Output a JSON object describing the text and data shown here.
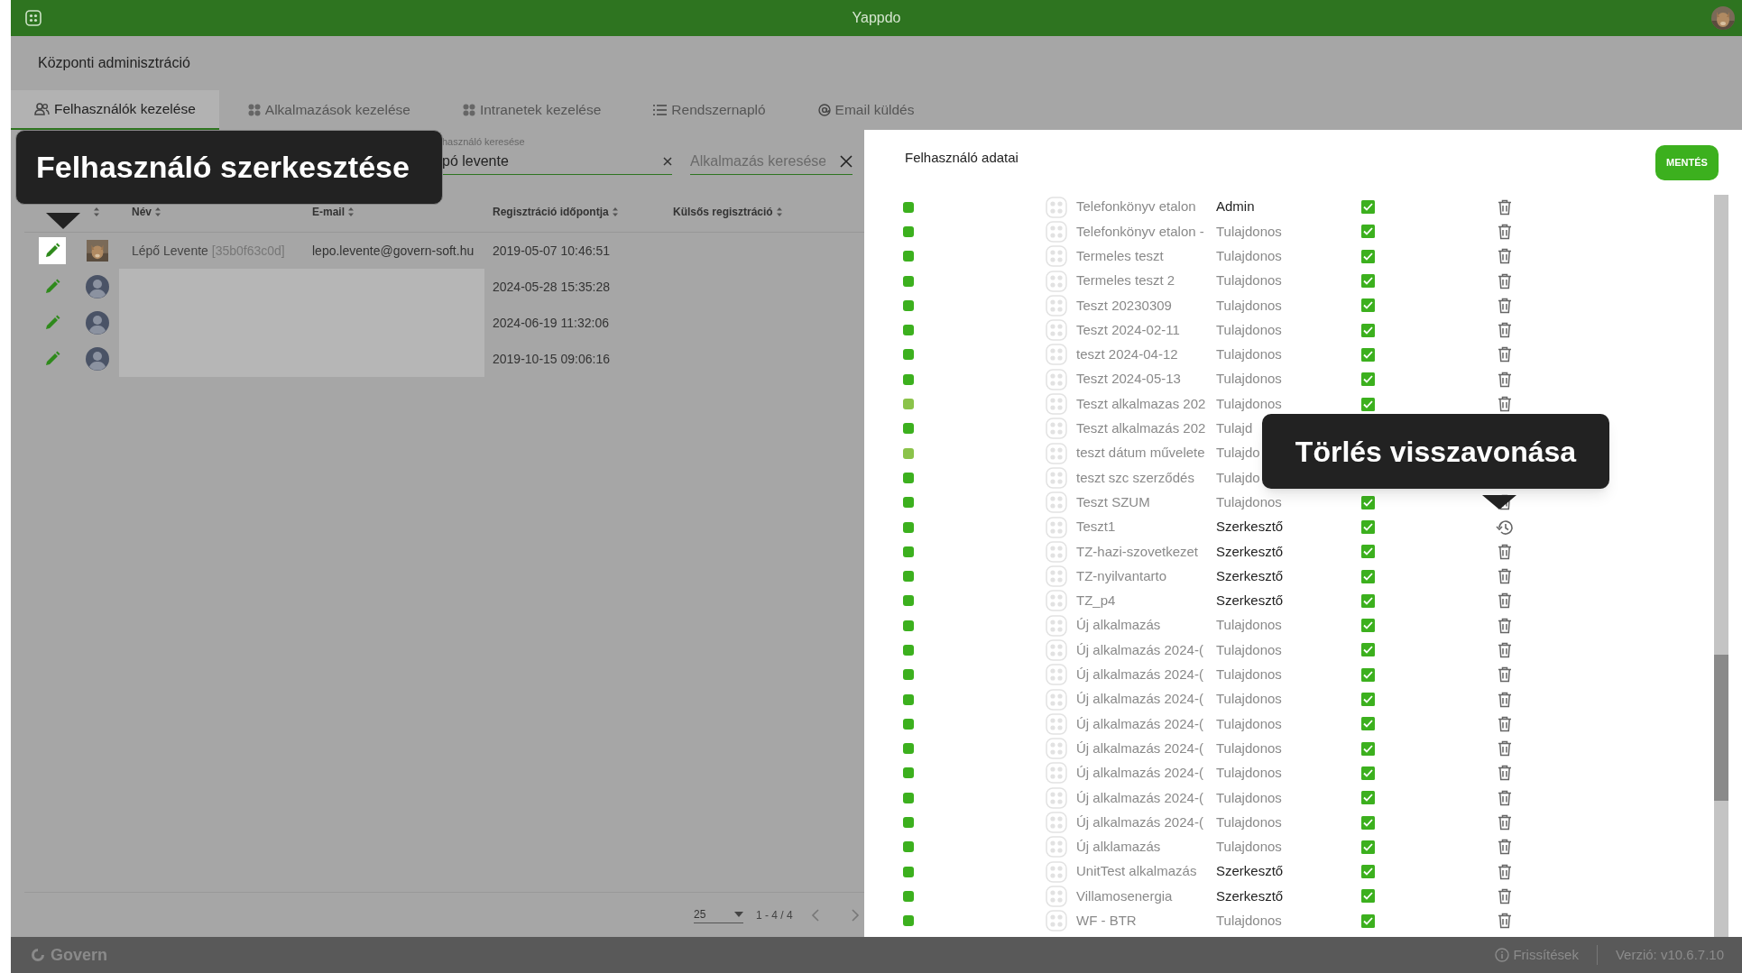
{
  "top_bar": {
    "title": "Yappdo"
  },
  "header": {
    "title": "Központi adminisztráció"
  },
  "tabs": [
    {
      "label": "Felhasználók kezelése",
      "selected": true
    },
    {
      "label": "Alkalmazások kezelése",
      "selected": false
    },
    {
      "label": "Intranetek kezelése",
      "selected": false
    },
    {
      "label": "Rendszernapló",
      "selected": false
    },
    {
      "label": "Email küldés",
      "selected": false
    }
  ],
  "user_search": {
    "label": "használó keresése",
    "value": "pó levente"
  },
  "app_search": {
    "placeholder": "Alkalmazás keresése"
  },
  "tooltip_edit": {
    "text": "Felhasználó szerkesztése"
  },
  "table": {
    "columns": [
      "Név",
      "E-mail",
      "Regisztráció időpontja",
      "Külsős regisztráció"
    ],
    "rows": [
      {
        "selected": true,
        "blurred": false,
        "name": "Lépő Levente",
        "id": "[35b0f63c0d]",
        "email": "lepo.levente@govern-soft.hu",
        "registered": "2019-05-07 10:46:51"
      },
      {
        "selected": false,
        "kind": "default",
        "blurred": true,
        "registered": "2024-05-28 15:35:28"
      },
      {
        "selected": false,
        "kind": "default",
        "blurred": true,
        "registered": "2024-06-19 11:32:06"
      },
      {
        "selected": false,
        "kind": "default",
        "blurred": true,
        "registered": "2019-10-15 09:06:16"
      }
    ]
  },
  "pagination": {
    "page_size": "25",
    "range": "1 - 4 / 4"
  },
  "panel": {
    "title": "Felhasználó adatai",
    "save_button": "MENTÉS"
  },
  "tooltip_restore": {
    "text": "Törlés visszavonása"
  },
  "apps": [
    {
      "color": "#3cb01e",
      "name": "Telefonkönyv etalon",
      "role": "Admin",
      "highlight": true,
      "checked": true,
      "kind": "delete"
    },
    {
      "color": "#3cb01e",
      "name": "Telefonkönyv etalon -",
      "role": "Tulajdonos",
      "highlight": false,
      "checked": true,
      "kind": "delete"
    },
    {
      "color": "#3cb01e",
      "name": "Termeles teszt",
      "role": "Tulajdonos",
      "highlight": false,
      "checked": true,
      "kind": "delete"
    },
    {
      "color": "#3cb01e",
      "name": "Termeles teszt 2",
      "role": "Tulajdonos",
      "highlight": false,
      "checked": true,
      "kind": "delete"
    },
    {
      "color": "#3cb01e",
      "name": "Teszt 20230309",
      "role": "Tulajdonos",
      "highlight": false,
      "checked": true,
      "kind": "delete"
    },
    {
      "color": "#3cb01e",
      "name": "Teszt 2024-02-11",
      "role": "Tulajdonos",
      "highlight": false,
      "checked": true,
      "kind": "delete"
    },
    {
      "color": "#3cb01e",
      "name": "teszt 2024-04-12",
      "role": "Tulajdonos",
      "highlight": false,
      "checked": true,
      "kind": "delete"
    },
    {
      "color": "#3cb01e",
      "name": "Teszt 2024-05-13",
      "role": "Tulajdonos",
      "highlight": false,
      "checked": true,
      "kind": "delete"
    },
    {
      "color": "#8bc34a",
      "name": "Teszt alkalmazas 202",
      "role": "Tulajdonos",
      "highlight": false,
      "checked": true,
      "kind": "delete"
    },
    {
      "color": "#3cb01e",
      "name": "Teszt alkalmazás 202",
      "role": "Tulajd",
      "highlight": false
    },
    {
      "color": "#8bc34a",
      "name": "teszt dátum művelete",
      "role": "Tulajdo",
      "highlight": false
    },
    {
      "color": "#3cb01e",
      "name": "teszt szc szerződés",
      "role": "Tulajdo",
      "highlight": false
    },
    {
      "color": "#3cb01e",
      "name": "Teszt SZUM",
      "role": "Tulajdonos",
      "highlight": false,
      "checked": true,
      "kind": "delete"
    },
    {
      "color": "#3cb01e",
      "name": "Teszt1",
      "role": "Szerkesztő",
      "highlight": true,
      "checked": true,
      "kind": "restore"
    },
    {
      "color": "#3cb01e",
      "name": "TZ-hazi-szovetkezet",
      "role": "Szerkesztő",
      "highlight": true,
      "checked": true,
      "kind": "delete"
    },
    {
      "color": "#3cb01e",
      "name": "TZ-nyilvantarto",
      "role": "Szerkesztő",
      "highlight": true,
      "checked": true,
      "kind": "delete"
    },
    {
      "color": "#3cb01e",
      "name": "TZ_p4",
      "role": "Szerkesztő",
      "highlight": true,
      "checked": true,
      "kind": "delete"
    },
    {
      "color": "#3cb01e",
      "name": "Új alkalmazás",
      "role": "Tulajdonos",
      "highlight": false,
      "checked": true,
      "kind": "delete"
    },
    {
      "color": "#3cb01e",
      "name": "Új alkalmazás 2024-(",
      "role": "Tulajdonos",
      "highlight": false,
      "checked": true,
      "kind": "delete"
    },
    {
      "color": "#3cb01e",
      "name": "Új alkalmazás 2024-(",
      "role": "Tulajdonos",
      "highlight": false,
      "checked": true,
      "kind": "delete"
    },
    {
      "color": "#3cb01e",
      "name": "Új alkalmazás 2024-(",
      "role": "Tulajdonos",
      "highlight": false,
      "checked": true,
      "kind": "delete"
    },
    {
      "color": "#3cb01e",
      "name": "Új alkalmazás 2024-(",
      "role": "Tulajdonos",
      "highlight": false,
      "checked": true,
      "kind": "delete"
    },
    {
      "color": "#3cb01e",
      "name": "Új alkalmazás 2024-(",
      "role": "Tulajdonos",
      "highlight": false,
      "checked": true,
      "kind": "delete"
    },
    {
      "color": "#3cb01e",
      "name": "Új alkalmazás 2024-(",
      "role": "Tulajdonos",
      "highlight": false,
      "checked": true,
      "kind": "delete"
    },
    {
      "color": "#3cb01e",
      "name": "Új alkalmazás 2024-(",
      "role": "Tulajdonos",
      "highlight": false,
      "checked": true,
      "kind": "delete"
    },
    {
      "color": "#3cb01e",
      "name": "Új alkalmazás 2024-(",
      "role": "Tulajdonos",
      "highlight": false,
      "checked": true,
      "kind": "delete"
    },
    {
      "color": "#3cb01e",
      "name": "Új alklamazás",
      "role": "Tulajdonos",
      "highlight": false,
      "checked": true,
      "kind": "delete"
    },
    {
      "color": "#3cb01e",
      "name": "UnitTest alkalmazás",
      "role": "Szerkesztő",
      "highlight": true,
      "checked": true,
      "kind": "delete"
    },
    {
      "color": "#3cb01e",
      "name": "Villamosenergia",
      "role": "Szerkesztő",
      "highlight": true,
      "checked": true,
      "kind": "delete"
    },
    {
      "color": "#3cb01e",
      "name": "WF - BTR",
      "role": "Tulajdonos",
      "highlight": false,
      "checked": true,
      "kind": "delete"
    }
  ],
  "footer": {
    "logo": "Govern",
    "updates": "Frissítések",
    "version": "Verzió: v10.6.7.10"
  }
}
